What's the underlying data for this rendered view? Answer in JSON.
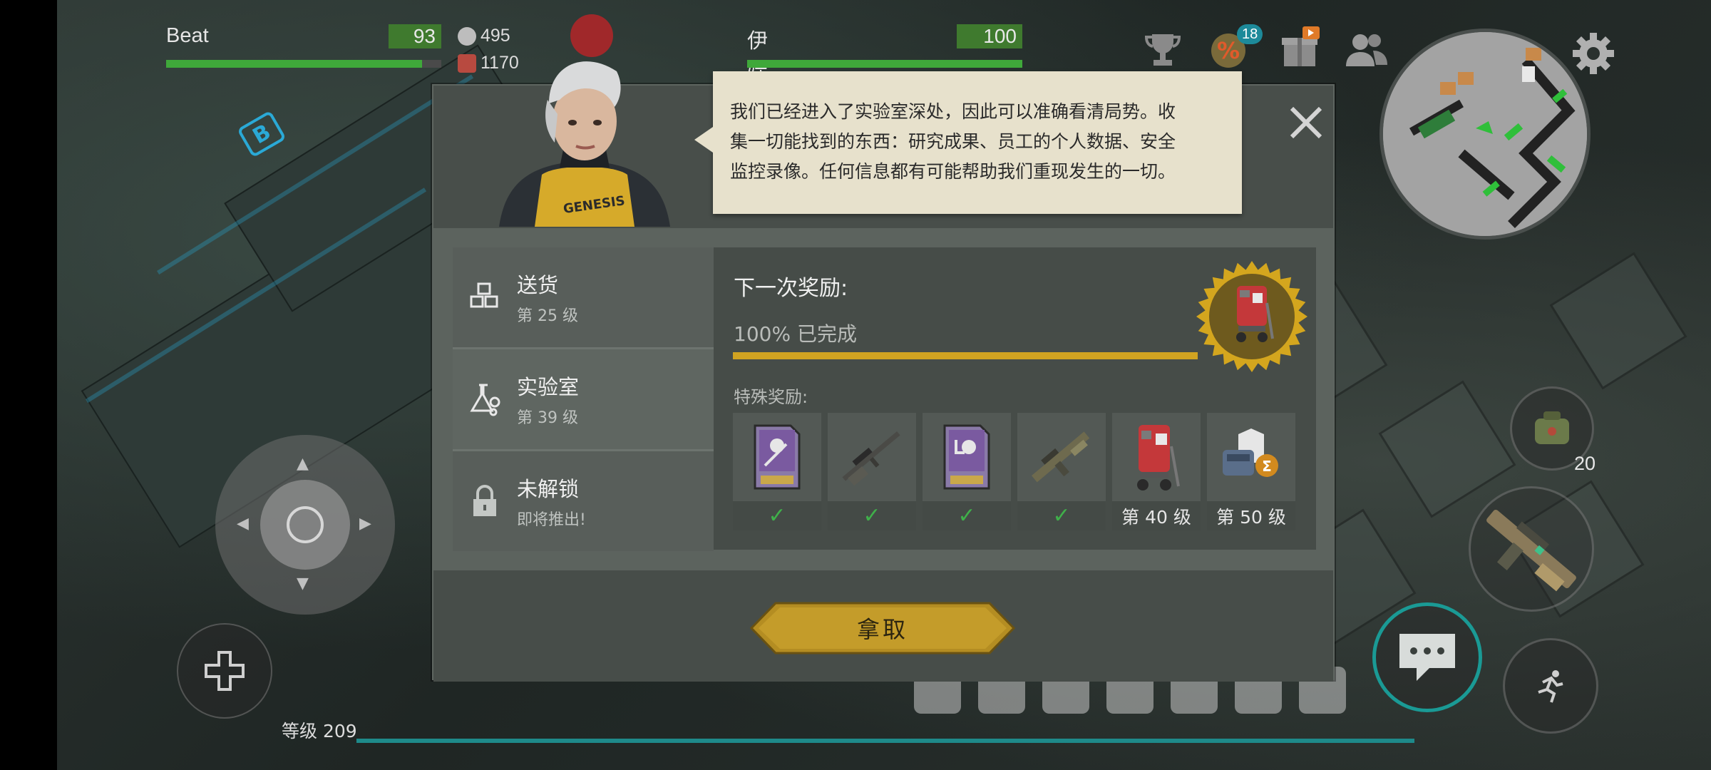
{
  "players": [
    {
      "name": "Beat",
      "hp": "93",
      "hp_fraction": 0.93
    },
    {
      "name": "伊娃",
      "hp": "100",
      "hp_fraction": 1.0
    }
  ],
  "stats": {
    "energy": "495",
    "ammo": "1170"
  },
  "top_icons": {
    "trophy": "trophy-icon",
    "discount": "discount-icon",
    "discount_badge": "18",
    "gift": "gift-icon",
    "friends": "friends-icon",
    "settings": "gear-icon"
  },
  "hud": {
    "level_label": "等级 209",
    "grenade_count": "20"
  },
  "dialog": {
    "text_lines": [
      "我们已经进入了实验室深处，因此可以准确看清局势。收",
      "集一切能找到的东西：研究成果、员工的个人数据、安全",
      "监控录像。任何信息都有可能帮助我们重现发生的一切。"
    ]
  },
  "tabs": [
    {
      "title": "送货",
      "subtitle": "第 25 级",
      "icon": "boxes-icon"
    },
    {
      "title": "实验室",
      "subtitle": "第 39 级",
      "icon": "flask-icon"
    },
    {
      "title": "未解锁",
      "subtitle": "即将推出!",
      "icon": "lock-icon"
    }
  ],
  "reward": {
    "next_reward_label": "下一次奖励:",
    "progress_text": "100% 已完成",
    "progress_fraction": 1.0,
    "special_reward_label": "特殊奖励:",
    "items": [
      {
        "name": "skull-card-icon",
        "status": "✓"
      },
      {
        "name": "sniper-rifle-icon",
        "status": "✓"
      },
      {
        "name": "skull-card-down-icon",
        "status": "✓"
      },
      {
        "name": "assault-rifle-icon",
        "status": "✓"
      },
      {
        "name": "loot-cart-icon",
        "status": "第 40 级"
      },
      {
        "name": "gear-bundle-icon",
        "status": "第 50 级"
      }
    ]
  },
  "claim_button_label": "拿取",
  "colors": {
    "accent_gold": "#d1a321",
    "hp_green": "#3fa83a",
    "check_green": "#3fb04a",
    "dialog_bg": "#e7e1cc"
  }
}
